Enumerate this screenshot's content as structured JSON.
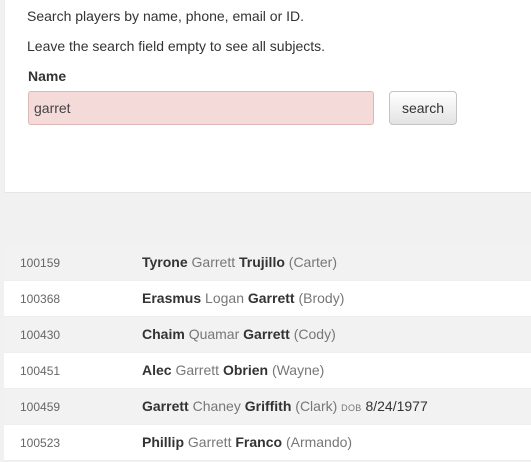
{
  "search": {
    "instruction": "Search players by name, phone, email or ID.",
    "empty_hint": "Leave the search field empty to see all subjects.",
    "name_label": "Name",
    "query": "garret",
    "button_label": "search"
  },
  "results": [
    {
      "id": "100159",
      "first": "Tyrone",
      "middle": "Garrett",
      "last": "Trujillo",
      "alias": "(Carter)"
    },
    {
      "id": "100368",
      "first": "Erasmus",
      "middle": "Logan",
      "last": "Garrett",
      "alias": "(Brody)"
    },
    {
      "id": "100430",
      "first": "Chaim",
      "middle": "Quamar",
      "last": "Garrett",
      "alias": "(Cody)"
    },
    {
      "id": "100451",
      "first": "Alec",
      "middle": "Garrett",
      "last": "Obrien",
      "alias": "(Wayne)"
    },
    {
      "id": "100459",
      "first": "Garrett",
      "middle": "Chaney",
      "last": "Griffith",
      "alias": "(Clark)",
      "dob_label": "DOB",
      "dob": "8/24/1977"
    },
    {
      "id": "100523",
      "first": "Phillip",
      "middle": "Garrett",
      "last": "Franco",
      "alias": "(Armando)"
    }
  ]
}
